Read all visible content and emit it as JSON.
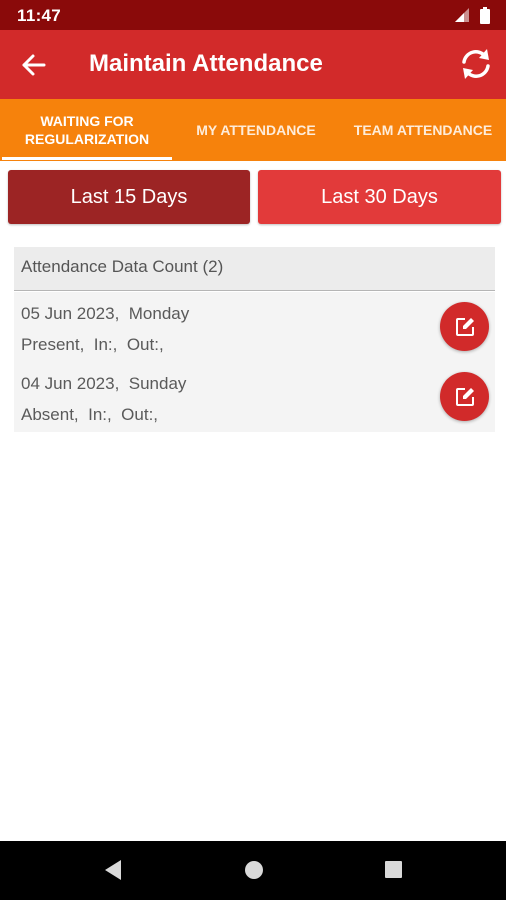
{
  "status_bar": {
    "time": "11:47",
    "icons": [
      "signal-icon",
      "battery-icon"
    ]
  },
  "app_bar": {
    "title": "Maintain Attendance",
    "back_icon": "back-arrow-icon",
    "refresh_icon": "refresh-icon"
  },
  "tabs": [
    {
      "label": "WAITING FOR\nREGULARIZATION",
      "selected": true
    },
    {
      "label": "MY ATTENDANCE",
      "selected": false
    },
    {
      "label": "TEAM ATTENDANCE",
      "selected": false
    }
  ],
  "range_buttons": [
    {
      "label": "Last 15 Days",
      "selected": true
    },
    {
      "label": "Last 30 Days",
      "selected": false
    }
  ],
  "list": {
    "header": "Attendance Data Count (2)",
    "rows": [
      {
        "date_line": "05 Jun 2023,  Monday",
        "status_line": "Present,  In:,  Out:,"
      },
      {
        "date_line": "04 Jun 2023,  Sunday",
        "status_line": "Absent,  In:,  Out:,"
      }
    ]
  },
  "colors": {
    "status_bar": "#8a0a0a",
    "app_bar": "#d22a2a",
    "tab_bar": "#f6820c",
    "range_selected": "#9c2424",
    "range_unselected": "#e23a3a",
    "edit_button": "#d12a2a"
  },
  "nav_bar": {
    "icons": [
      "back-triangle-icon",
      "home-circle-icon",
      "recents-square-icon"
    ]
  }
}
